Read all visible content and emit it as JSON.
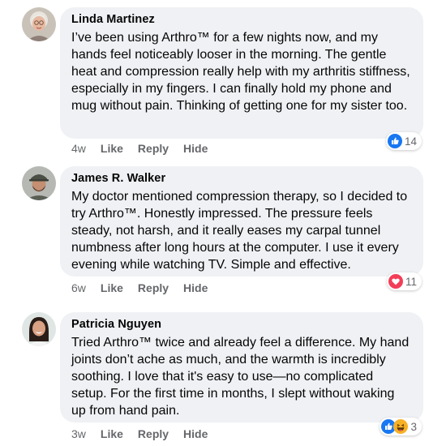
{
  "comments": [
    {
      "author": "Linda Martinez",
      "avatar": "elderly-woman-avatar",
      "text": "I’ve been using Arthro™ for a few nights now, and my hands feel noticeably looser in the morning. The gentle heat and compression really help with my arthritis stiffness, especially in my fingers. I can finally hold my phone and mug without pain. Thinking of getting one for my sister too.",
      "age": "4w",
      "like_label": "Like",
      "reply_label": "Reply",
      "hide_label": "Hide",
      "reaction_icons": [
        "like-icon"
      ],
      "reaction_count": "14"
    },
    {
      "author": "James R. Walker",
      "avatar": "bearded-man-cap-avatar",
      "text": "My doctor mentioned compression therapy, so I decided to try Arthro™. Honestly impressed. The pressure feels steady, not harsh, and it really eases my carpal tunnel numbness after long hours at the computer. I use it every evening while watching TV. Simple and effective.",
      "age": "6w",
      "like_label": "Like",
      "reply_label": "Reply",
      "hide_label": "Hide",
      "reaction_icons": [
        "love-icon"
      ],
      "reaction_count": "11"
    },
    {
      "author": "Patricia Nguyen",
      "avatar": "smiling-woman-avatar",
      "text": "Tried Arthro™ twice and already feel a difference. My hand joints don’t ache as much, and the warmth is incredibly soothing. I love that it's easy to use—no complicated setup. For the first time in months, I slept without waking up from hand pain.",
      "age": "3w",
      "like_label": "Like",
      "reply_label": "Reply",
      "hide_label": "Hide",
      "reaction_icons": [
        "like-icon",
        "haha-icon"
      ],
      "reaction_count": "3"
    }
  ],
  "colors": {
    "bubble": "#eff1f4",
    "meta_text": "#65676b",
    "like_blue": "#1877f2",
    "love_red": "#f33e58",
    "haha_yellow": "#f7b125"
  }
}
